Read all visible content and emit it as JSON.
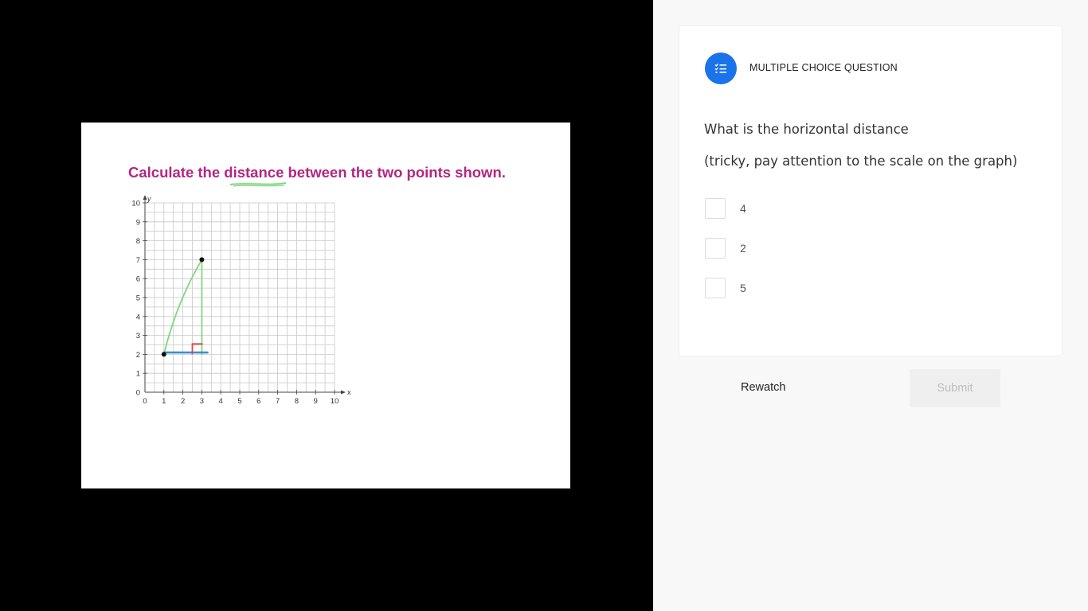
{
  "slide": {
    "title_pre": "Calculate the ",
    "title_word": "distance",
    "title_post": " between the two points shown."
  },
  "chart_data": {
    "type": "scatter",
    "xlabel": "x",
    "ylabel": "y",
    "xlim": [
      0,
      10
    ],
    "ylim": [
      0,
      10
    ],
    "x_ticks": [
      0,
      1,
      2,
      3,
      4,
      5,
      6,
      7,
      8,
      9,
      10
    ],
    "y_ticks": [
      0,
      1,
      2,
      3,
      4,
      5,
      6,
      7,
      8,
      9,
      10
    ],
    "grid": true,
    "points": [
      {
        "x": 1,
        "y": 2
      },
      {
        "x": 3,
        "y": 7
      }
    ],
    "annotations": [
      {
        "type": "hypotenuse",
        "color": "#7ed87e",
        "from": [
          1,
          2
        ],
        "to": [
          3,
          7
        ]
      },
      {
        "type": "vertical-leg",
        "color": "#7ed87e",
        "from": [
          3,
          7
        ],
        "to": [
          3,
          2
        ]
      },
      {
        "type": "horizontal-leg",
        "color": "#3a8fd0",
        "from": [
          1,
          2.1
        ],
        "to": [
          3.3,
          2.1
        ]
      },
      {
        "type": "right-angle-marker",
        "color": "#e04545",
        "at": [
          3,
          2
        ]
      }
    ]
  },
  "quiz": {
    "type_label": "MULTIPLE CHOICE QUESTION",
    "type_icon": "list-check-icon",
    "question_line1": "What is the horizontal distance",
    "question_line2": "(tricky, pay attention to the scale on the graph)",
    "options": [
      {
        "label": "4",
        "checked": false
      },
      {
        "label": "2",
        "checked": false
      },
      {
        "label": "5",
        "checked": false
      }
    ],
    "rewatch_label": "Rewatch",
    "submit_label": "Submit",
    "submit_enabled": false
  },
  "colors": {
    "accent": "#1a73e8",
    "title": "#b4267f"
  }
}
